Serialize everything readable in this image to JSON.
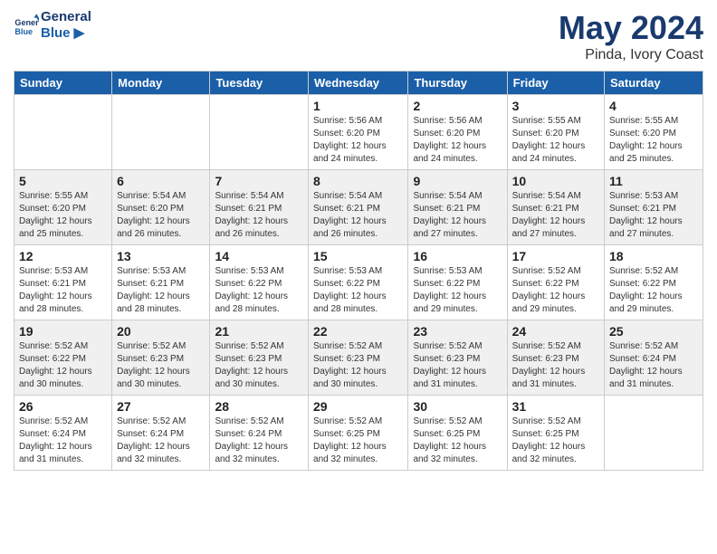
{
  "header": {
    "logo_line1": "General",
    "logo_line2": "Blue",
    "month": "May 2024",
    "location": "Pinda, Ivory Coast"
  },
  "weekdays": [
    "Sunday",
    "Monday",
    "Tuesday",
    "Wednesday",
    "Thursday",
    "Friday",
    "Saturday"
  ],
  "weeks": [
    [
      {
        "day": "",
        "info": ""
      },
      {
        "day": "",
        "info": ""
      },
      {
        "day": "",
        "info": ""
      },
      {
        "day": "1",
        "info": "Sunrise: 5:56 AM\nSunset: 6:20 PM\nDaylight: 12 hours\nand 24 minutes."
      },
      {
        "day": "2",
        "info": "Sunrise: 5:56 AM\nSunset: 6:20 PM\nDaylight: 12 hours\nand 24 minutes."
      },
      {
        "day": "3",
        "info": "Sunrise: 5:55 AM\nSunset: 6:20 PM\nDaylight: 12 hours\nand 24 minutes."
      },
      {
        "day": "4",
        "info": "Sunrise: 5:55 AM\nSunset: 6:20 PM\nDaylight: 12 hours\nand 25 minutes."
      }
    ],
    [
      {
        "day": "5",
        "info": "Sunrise: 5:55 AM\nSunset: 6:20 PM\nDaylight: 12 hours\nand 25 minutes."
      },
      {
        "day": "6",
        "info": "Sunrise: 5:54 AM\nSunset: 6:20 PM\nDaylight: 12 hours\nand 26 minutes."
      },
      {
        "day": "7",
        "info": "Sunrise: 5:54 AM\nSunset: 6:21 PM\nDaylight: 12 hours\nand 26 minutes."
      },
      {
        "day": "8",
        "info": "Sunrise: 5:54 AM\nSunset: 6:21 PM\nDaylight: 12 hours\nand 26 minutes."
      },
      {
        "day": "9",
        "info": "Sunrise: 5:54 AM\nSunset: 6:21 PM\nDaylight: 12 hours\nand 27 minutes."
      },
      {
        "day": "10",
        "info": "Sunrise: 5:54 AM\nSunset: 6:21 PM\nDaylight: 12 hours\nand 27 minutes."
      },
      {
        "day": "11",
        "info": "Sunrise: 5:53 AM\nSunset: 6:21 PM\nDaylight: 12 hours\nand 27 minutes."
      }
    ],
    [
      {
        "day": "12",
        "info": "Sunrise: 5:53 AM\nSunset: 6:21 PM\nDaylight: 12 hours\nand 28 minutes."
      },
      {
        "day": "13",
        "info": "Sunrise: 5:53 AM\nSunset: 6:21 PM\nDaylight: 12 hours\nand 28 minutes."
      },
      {
        "day": "14",
        "info": "Sunrise: 5:53 AM\nSunset: 6:22 PM\nDaylight: 12 hours\nand 28 minutes."
      },
      {
        "day": "15",
        "info": "Sunrise: 5:53 AM\nSunset: 6:22 PM\nDaylight: 12 hours\nand 28 minutes."
      },
      {
        "day": "16",
        "info": "Sunrise: 5:53 AM\nSunset: 6:22 PM\nDaylight: 12 hours\nand 29 minutes."
      },
      {
        "day": "17",
        "info": "Sunrise: 5:52 AM\nSunset: 6:22 PM\nDaylight: 12 hours\nand 29 minutes."
      },
      {
        "day": "18",
        "info": "Sunrise: 5:52 AM\nSunset: 6:22 PM\nDaylight: 12 hours\nand 29 minutes."
      }
    ],
    [
      {
        "day": "19",
        "info": "Sunrise: 5:52 AM\nSunset: 6:22 PM\nDaylight: 12 hours\nand 30 minutes."
      },
      {
        "day": "20",
        "info": "Sunrise: 5:52 AM\nSunset: 6:23 PM\nDaylight: 12 hours\nand 30 minutes."
      },
      {
        "day": "21",
        "info": "Sunrise: 5:52 AM\nSunset: 6:23 PM\nDaylight: 12 hours\nand 30 minutes."
      },
      {
        "day": "22",
        "info": "Sunrise: 5:52 AM\nSunset: 6:23 PM\nDaylight: 12 hours\nand 30 minutes."
      },
      {
        "day": "23",
        "info": "Sunrise: 5:52 AM\nSunset: 6:23 PM\nDaylight: 12 hours\nand 31 minutes."
      },
      {
        "day": "24",
        "info": "Sunrise: 5:52 AM\nSunset: 6:23 PM\nDaylight: 12 hours\nand 31 minutes."
      },
      {
        "day": "25",
        "info": "Sunrise: 5:52 AM\nSunset: 6:24 PM\nDaylight: 12 hours\nand 31 minutes."
      }
    ],
    [
      {
        "day": "26",
        "info": "Sunrise: 5:52 AM\nSunset: 6:24 PM\nDaylight: 12 hours\nand 31 minutes."
      },
      {
        "day": "27",
        "info": "Sunrise: 5:52 AM\nSunset: 6:24 PM\nDaylight: 12 hours\nand 32 minutes."
      },
      {
        "day": "28",
        "info": "Sunrise: 5:52 AM\nSunset: 6:24 PM\nDaylight: 12 hours\nand 32 minutes."
      },
      {
        "day": "29",
        "info": "Sunrise: 5:52 AM\nSunset: 6:25 PM\nDaylight: 12 hours\nand 32 minutes."
      },
      {
        "day": "30",
        "info": "Sunrise: 5:52 AM\nSunset: 6:25 PM\nDaylight: 12 hours\nand 32 minutes."
      },
      {
        "day": "31",
        "info": "Sunrise: 5:52 AM\nSunset: 6:25 PM\nDaylight: 12 hours\nand 32 minutes."
      },
      {
        "day": "",
        "info": ""
      }
    ]
  ]
}
